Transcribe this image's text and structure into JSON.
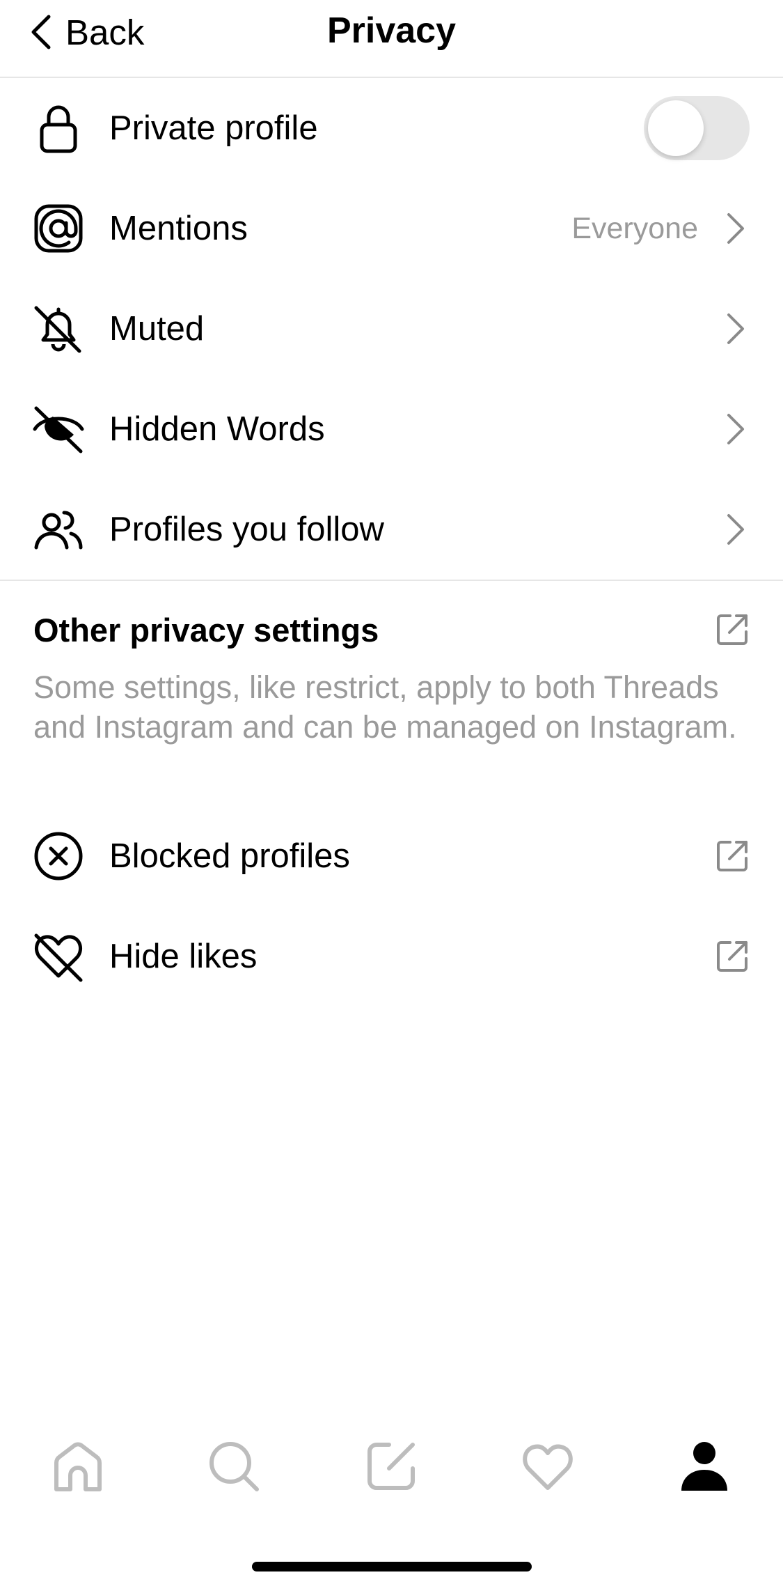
{
  "header": {
    "back_label": "Back",
    "title": "Privacy"
  },
  "settings": {
    "private_profile": {
      "label": "Private profile",
      "icon": "lock-icon",
      "toggle_on": false
    },
    "mentions": {
      "label": "Mentions",
      "value": "Everyone",
      "icon": "at-sign-icon"
    },
    "muted": {
      "label": "Muted",
      "icon": "bell-off-icon"
    },
    "hidden_words": {
      "label": "Hidden Words",
      "icon": "eye-off-icon"
    },
    "profiles_you_follow": {
      "label": "Profiles you follow",
      "icon": "people-icon"
    }
  },
  "other_privacy": {
    "title": "Other privacy settings",
    "description": "Some settings, like restrict, apply to both Threads and Instagram and can be managed on Instagram.",
    "items": {
      "blocked_profiles": {
        "label": "Blocked profiles",
        "icon": "x-circle-icon"
      },
      "hide_likes": {
        "label": "Hide likes",
        "icon": "heart-off-icon"
      }
    }
  },
  "tabbar": {
    "tabs": [
      "home-icon",
      "search-icon",
      "compose-icon",
      "heart-icon",
      "profile-icon"
    ],
    "active": "profile-icon"
  },
  "colors": {
    "text": "#000000",
    "secondary_text": "#9a9a9a",
    "divider": "#e6e6e6",
    "inactive_icon": "#bdbdbd",
    "toggle_off": "#e6e6e6"
  }
}
